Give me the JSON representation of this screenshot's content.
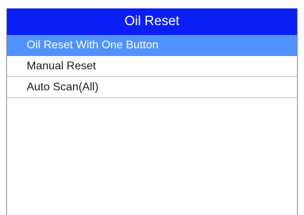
{
  "header": {
    "title": "Oil Reset"
  },
  "menu": {
    "selected_index": 0,
    "items": [
      {
        "label": "Oil Reset With One Button"
      },
      {
        "label": "Manual Reset"
      },
      {
        "label": "Auto Scan(All)"
      }
    ]
  },
  "colors": {
    "title_bar": "#0a1ff5",
    "selected_row": "#4f92ff",
    "divider": "#b9b9b9"
  }
}
